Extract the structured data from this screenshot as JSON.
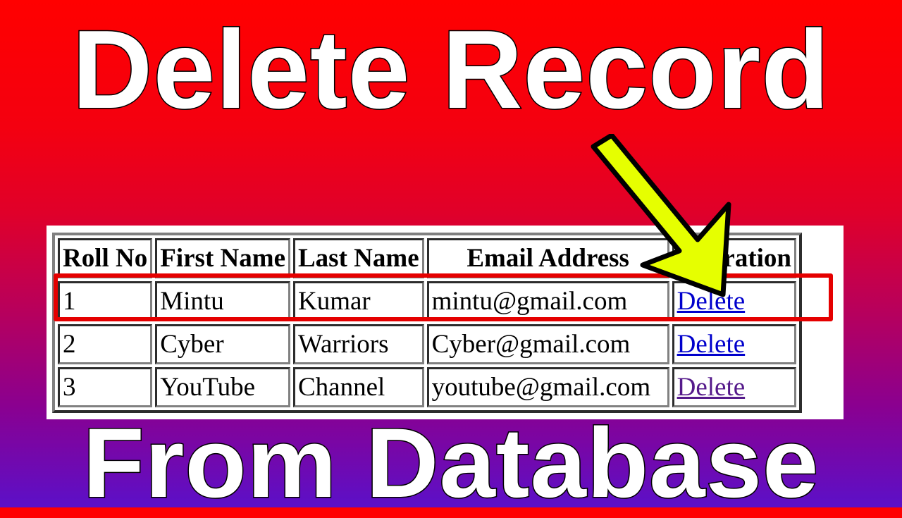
{
  "title_top": "Delete Record",
  "title_bottom": "From Database",
  "table": {
    "headers": [
      "Roll No",
      "First Name",
      "Last Name",
      "Email Address",
      "Operation"
    ],
    "rows": [
      {
        "roll": "1",
        "first": "Mintu",
        "last": "Kumar",
        "email": "mintu@gmail.com",
        "action": "Delete"
      },
      {
        "roll": "2",
        "first": "Cyber",
        "last": "Warriors",
        "email": "Cyber@gmail.com",
        "action": "Delete"
      },
      {
        "roll": "3",
        "first": "YouTube",
        "last": "Channel",
        "email": "youtube@gmail.com",
        "action": "Delete"
      }
    ],
    "highlighted_row": 1
  },
  "colors": {
    "bg_top": "#ff0000",
    "bg_bottom": "#5c10c8",
    "highlight": "#e50000",
    "arrow": "#e6ff00",
    "link": "#0000cc",
    "link_visited": "#551a8b"
  }
}
